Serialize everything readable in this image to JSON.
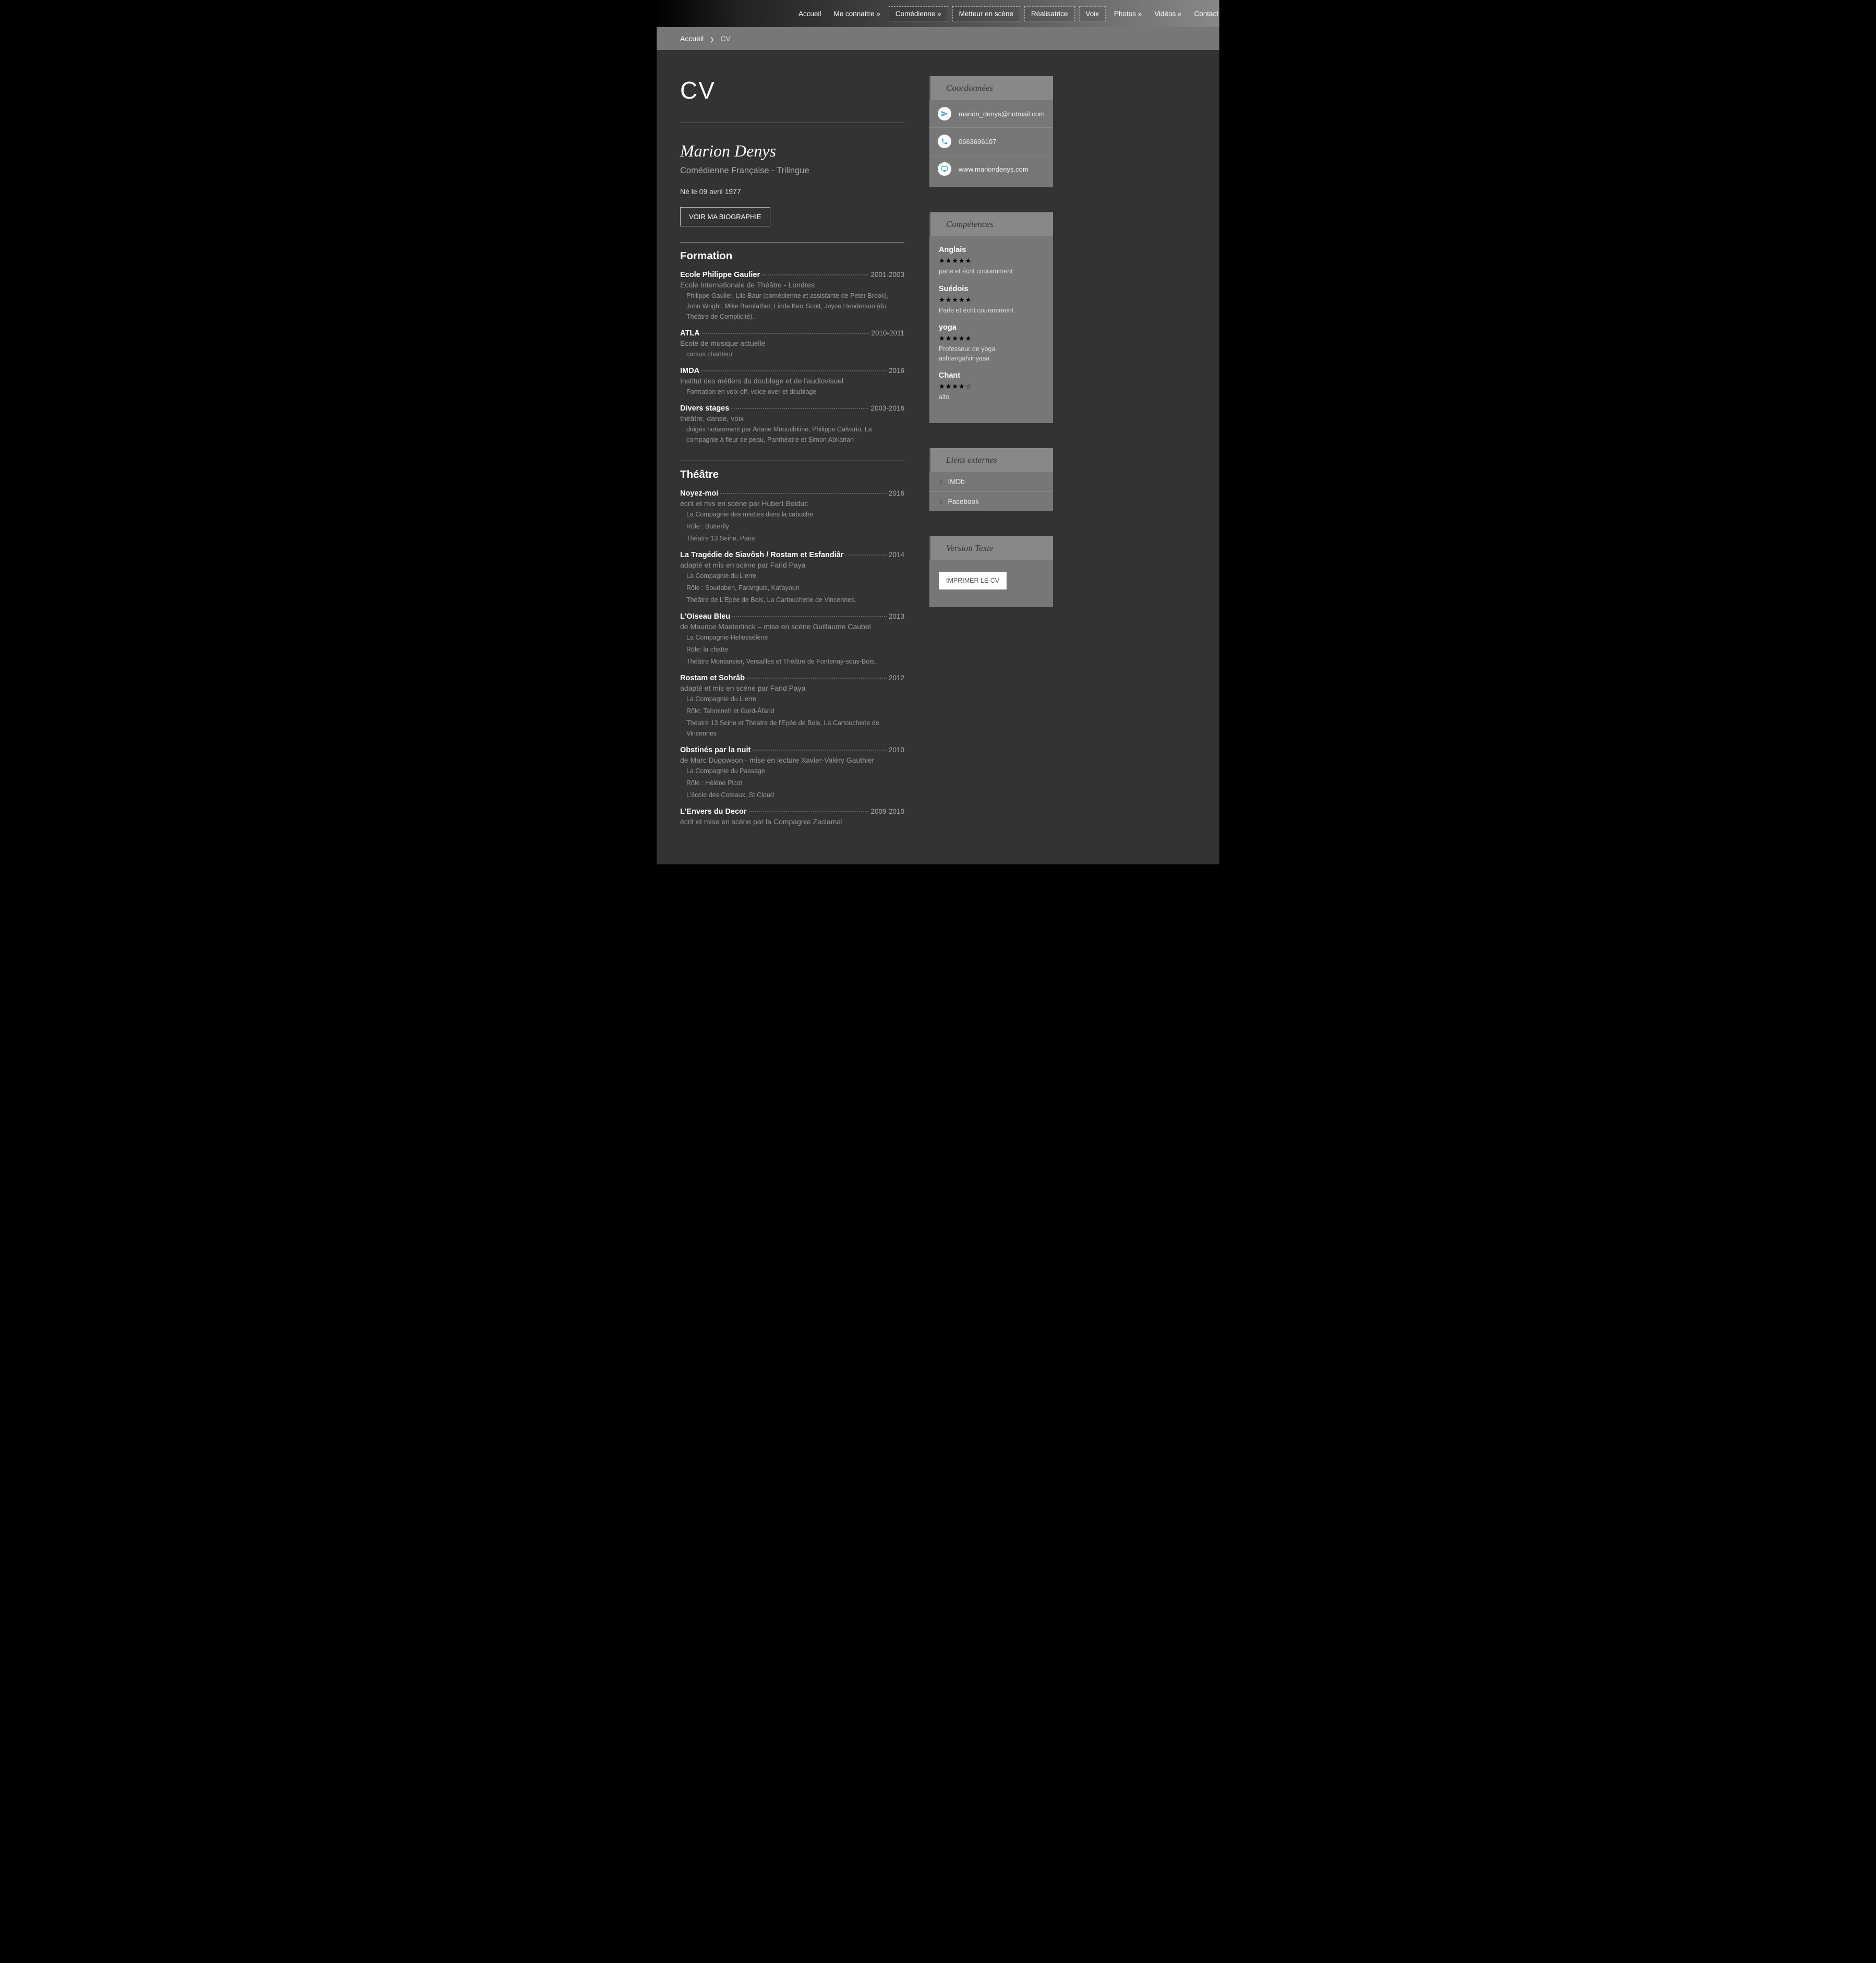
{
  "nav": [
    "Accueil",
    "Me connaitre »",
    "Comédienne »",
    "Metteur en scène",
    "Réalisatrice",
    "Voix",
    "Photos »",
    "Vidéos »",
    "Contact"
  ],
  "nav_boxed": [
    2,
    3,
    4,
    5
  ],
  "breadcrumb": {
    "home": "Accueil",
    "current": "CV"
  },
  "cv_title": "CV",
  "name": "Marion Denys",
  "subtitle": "Comédienne Française - Trilingue",
  "birth": "Né le 09 avril 1977",
  "bio_btn": "VOIR MA BIOGRAPHIE",
  "sections": {
    "formation": {
      "title": "Formation",
      "entries": [
        {
          "title": "Ecole Philippe Gaulier",
          "date": "2001-2003",
          "sub1": "Ecole Internationale de Théâtre - Londres",
          "sub2": "Philippe Gaulier, Lilo Baur (comédienne et assistante de Peter Brook), John Wright, Mike Barnfather, Linda Kerr Scott, Joyce Henderson (du Théâtre de Complicité)."
        },
        {
          "title": "ATLA",
          "date": "2010-2011",
          "sub1": "Ecole de musique actuelle",
          "sub2": "cursus chanteur"
        },
        {
          "title": "IMDA",
          "date": "2016",
          "sub1": "Institut des métiers du doublage et de l'audiovisuel",
          "sub2": "Formation en voix off, voice over et doublage"
        },
        {
          "title": "Divers stages",
          "date": "2003-2016",
          "sub1": "théâtre, danse, voix",
          "sub2": "dirigés notamment par Ariane Mnouchkine, Philippe Calvario, La compagnie à fleur de peau, Panthéatre et Simon Abkarian"
        }
      ]
    },
    "theatre": {
      "title": "Théâtre",
      "entries": [
        {
          "title": "Noyez-moi",
          "date": "2016",
          "sub1": "écrit et mis en scène par Hubert Bolduc",
          "sub2": "La Compagnie des miettes dans la caboche\nRôle : Butterfly\nThéatre 13 Seine, Paris"
        },
        {
          "title": "La Tragédie de Siavôsh / Rostam et Esfandiâr",
          "date": "2014",
          "sub1": "adapté et mis en scène par Farid Paya",
          "sub2": "La Compagnie du Lierre\nRôle : Soudabeh, Faranguis, Kaťayoun\nThéâtre de L'Epée de Bois, La Cartoucherie de Vincennes."
        },
        {
          "title": "L'Oiseau Bleu",
          "date": "2013",
          "sub1": "de Maurice Maeterlinck – mise en scène Guillaume Caubel",
          "sub2": "La Compagnie Heliosséléné\nRôle: la chatte\nThéâtre Montansier, Versailles et Théâtre de Fontenay-sous-Bois."
        },
        {
          "title": "Rostam et Sohrâb",
          "date": "2012",
          "sub1": "adapté et mis en scène par Farid Paya",
          "sub2": "La Compagnie du Lierre\nRôle: Tahmineh et Gord-Âfarid\nThéatre 13 Seine et Théatre de l'Epée de Bois, La Cartoucherie de Vincennes"
        },
        {
          "title": "Obstinés par la nuit",
          "date": "2010",
          "sub1": "de Marc Dugowson - mise en lecture Xavier-Valéry Gauthier",
          "sub2": "La Compagnie du Passage\nRôle : Hélène Picot\nL'école des Coteaux, St Cloud"
        },
        {
          "title": "L'Envers du Decor",
          "date": "2009-2010",
          "sub1": "écrit et mise en scène par la Compagnie Zaclama!",
          "sub2": ""
        }
      ]
    }
  },
  "sidebar": {
    "coords": {
      "title": "Coordonnées",
      "items": [
        {
          "icon": "send",
          "text": "marion_denys@hotmail.com"
        },
        {
          "icon": "phone",
          "text": "0663696107"
        },
        {
          "icon": "screen",
          "text": "www.mariondenys.com"
        }
      ]
    },
    "comp": {
      "title": "Compétences",
      "items": [
        {
          "name": "Anglais",
          "stars": 5,
          "note": "parle et écrit couramment"
        },
        {
          "name": "Suédois",
          "stars": 5,
          "note": "Parle et écrit couramment"
        },
        {
          "name": "yoga",
          "stars": 5,
          "note": "Professeur de yoga ashtanga/vinyasa"
        },
        {
          "name": "Chant",
          "stars": 4,
          "note": "alto"
        }
      ]
    },
    "links": {
      "title": "Liens externes",
      "items": [
        "IMDb",
        "Facebook"
      ]
    },
    "print": {
      "title": "Version Texte",
      "btn": "IMPRIMER LE CV"
    }
  }
}
